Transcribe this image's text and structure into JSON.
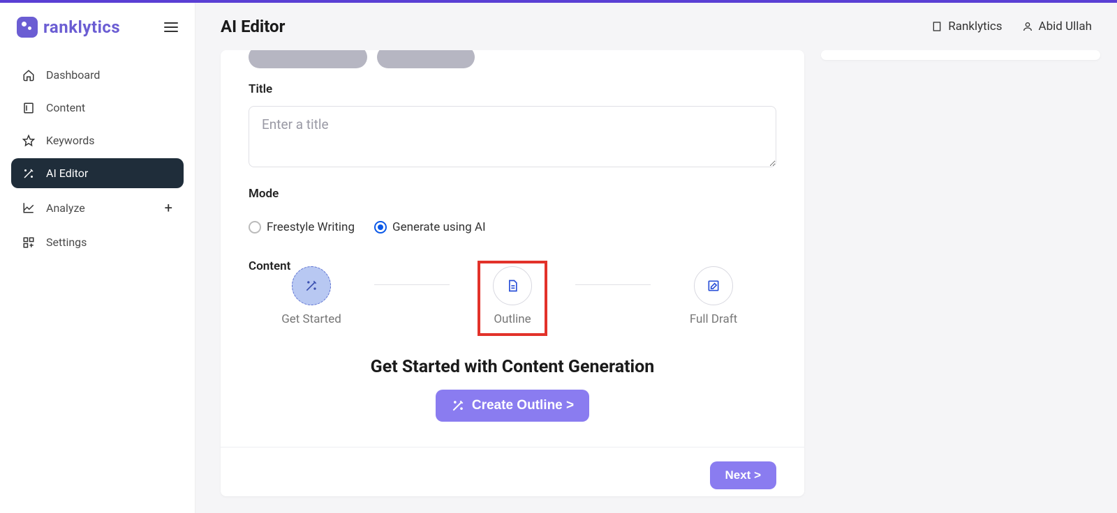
{
  "brand": {
    "name": "ranklytics"
  },
  "header": {
    "title": "AI Editor",
    "org": "Ranklytics",
    "user": "Abid Ullah"
  },
  "sidebar": {
    "items": [
      {
        "label": "Dashboard"
      },
      {
        "label": "Content"
      },
      {
        "label": "Keywords"
      },
      {
        "label": "AI Editor"
      },
      {
        "label": "Analyze"
      },
      {
        "label": "Settings"
      }
    ]
  },
  "form": {
    "title_label": "Title",
    "title_placeholder": "Enter a title",
    "mode_label": "Mode",
    "mode_options": {
      "freestyle": "Freestyle Writing",
      "ai": "Generate using AI"
    },
    "content_label": "Content",
    "steps": {
      "start": "Get Started",
      "outline": "Outline",
      "fulldraft": "Full Draft"
    },
    "generation_heading": "Get Started with Content Generation",
    "create_btn": "Create Outline >",
    "next_btn": "Next >"
  }
}
